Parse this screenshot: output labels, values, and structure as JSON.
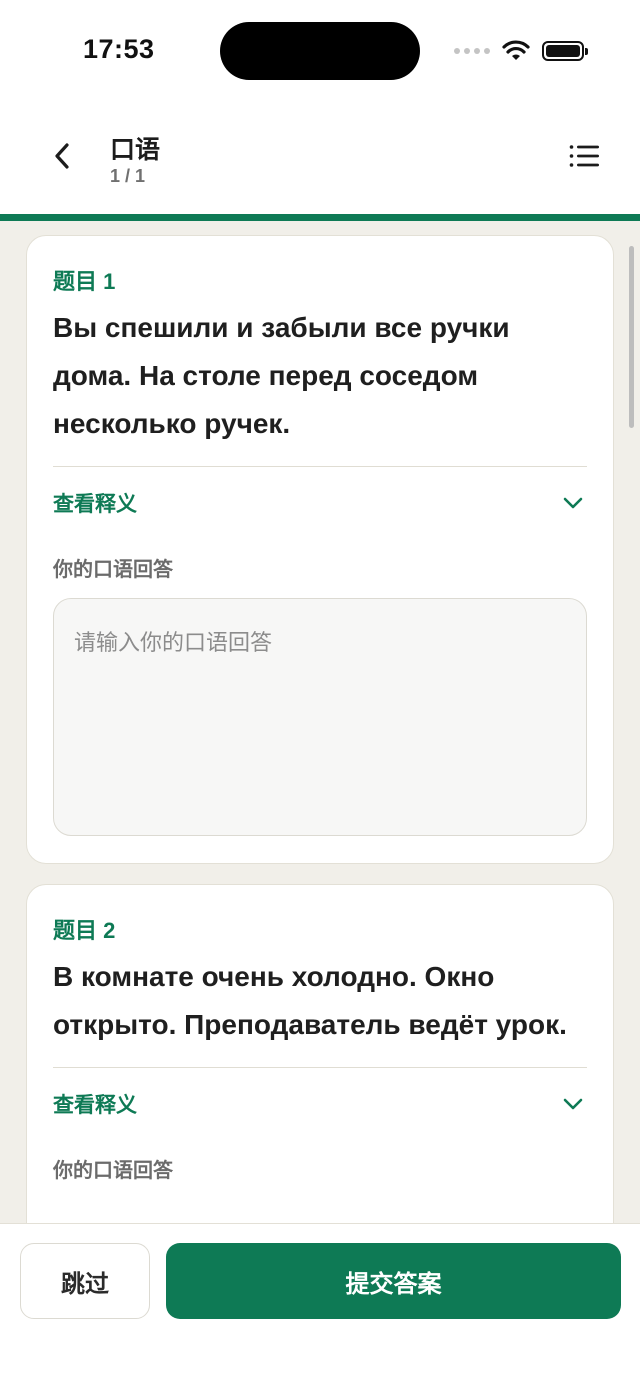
{
  "status_bar": {
    "time": "17:53"
  },
  "nav": {
    "title": "口语",
    "subtitle": "1 / 1"
  },
  "questions": [
    {
      "label": "题目 1",
      "text": "Вы спешили и забыли все ручки дома. На столе перед соседом несколько ручек.",
      "reveal_label": "查看释义",
      "answer_label": "你的口语回答",
      "answer_placeholder": "请输入你的口语回答"
    },
    {
      "label": "题目 2",
      "text": "В комнате очень холодно. Окно открыто. Преподаватель ведёт урок.",
      "reveal_label": "查看释义",
      "answer_label": "你的口语回答"
    }
  ],
  "footer": {
    "skip_label": "跳过",
    "submit_label": "提交答案"
  },
  "colors": {
    "accent": "#0e7a55",
    "background": "#f1efe9"
  }
}
